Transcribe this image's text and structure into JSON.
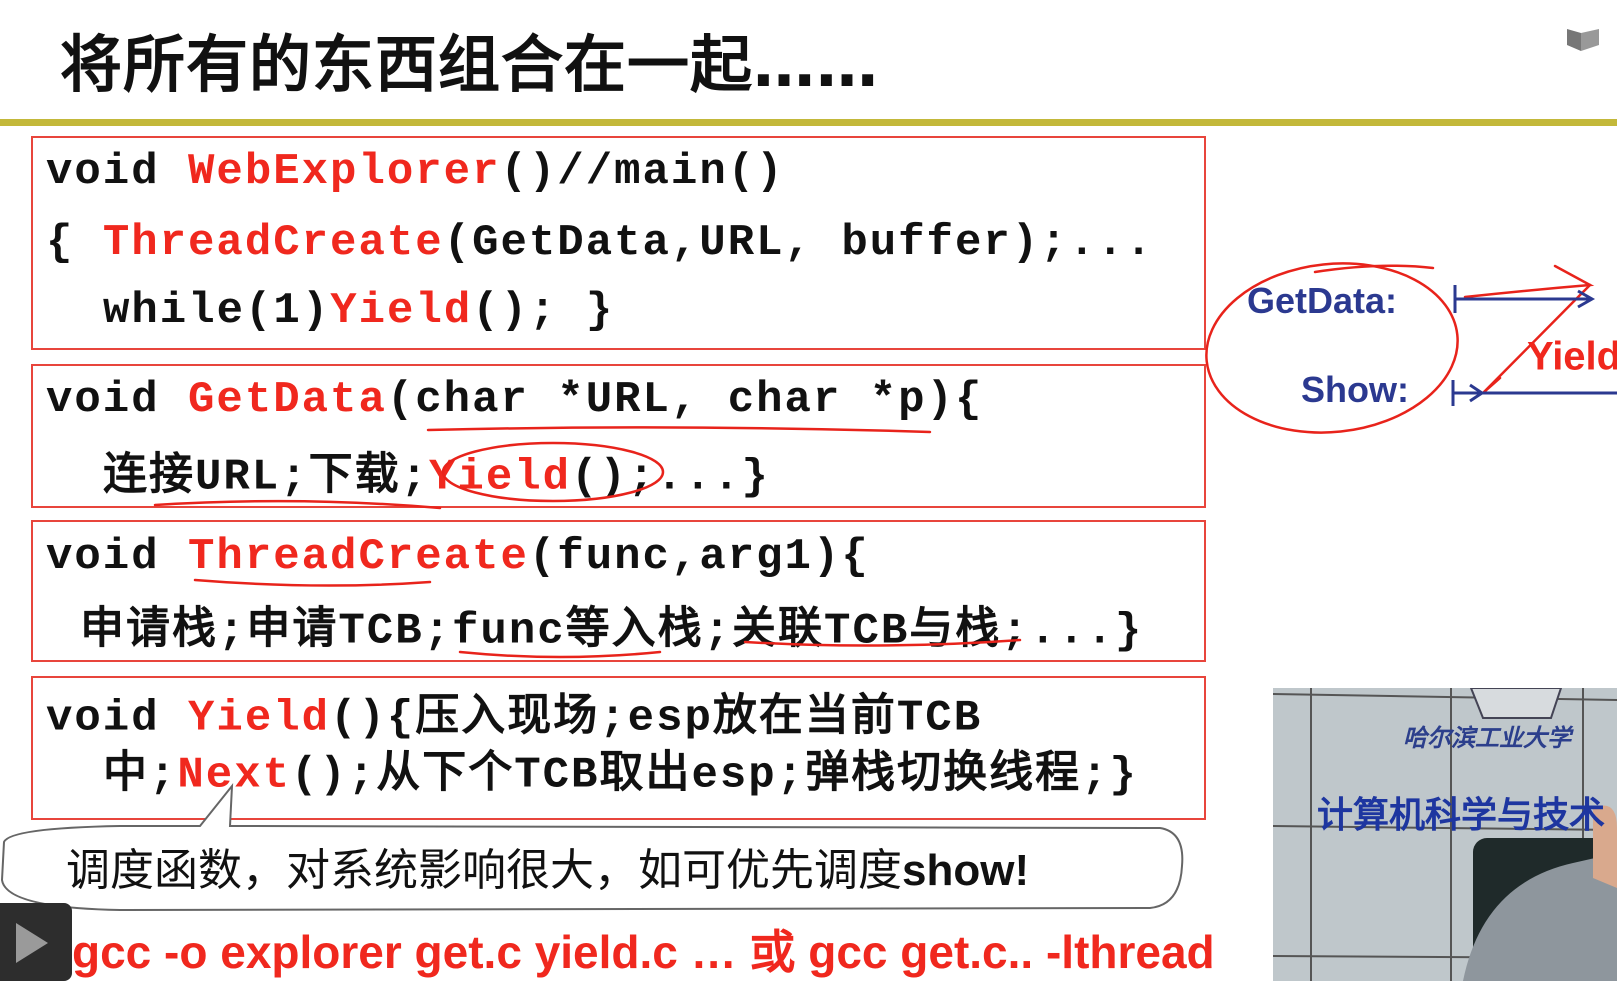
{
  "slide": {
    "title": "将所有的东西组合在一起……",
    "code_blocks": [
      {
        "lines": [
          [
            {
              "t": "void "
            },
            {
              "t": "WebExplorer",
              "r": true
            },
            {
              "t": "()//main()"
            }
          ],
          [
            {
              "t": "{ "
            },
            {
              "t": "ThreadCreate",
              "r": true
            },
            {
              "t": "(GetData,URL, buffer);..."
            }
          ],
          [
            {
              "t": "while(1)"
            },
            {
              "t": "Yield",
              "r": true
            },
            {
              "t": "(); }"
            }
          ]
        ]
      },
      {
        "lines": [
          [
            {
              "t": "void "
            },
            {
              "t": "GetData",
              "r": true
            },
            {
              "t": "(char *URL, char *p){"
            }
          ],
          [
            {
              "t": "连接URL;下载;"
            },
            {
              "t": "Yield",
              "r": true
            },
            {
              "t": "();...}"
            }
          ]
        ]
      },
      {
        "lines": [
          [
            {
              "t": "void "
            },
            {
              "t": "ThreadCreate",
              "r": true
            },
            {
              "t": "(func,arg1){"
            }
          ],
          [
            {
              "t": "申请栈;申请TCB;func等入栈;关联TCB与栈;...}"
            }
          ]
        ]
      },
      {
        "lines": [
          [
            {
              "t": "void "
            },
            {
              "t": "Yield",
              "r": true
            },
            {
              "t": "(){压入现场;esp放在当前TCB"
            }
          ],
          [
            {
              "t": "中;"
            },
            {
              "t": "Next",
              "r": true
            },
            {
              "t": "();从下个TCB取出esp;弹栈切换线程;}"
            }
          ]
        ]
      }
    ],
    "callout": {
      "text": "调度函数，对系统影响很大，如可优先调度",
      "bold": "show!"
    },
    "compile_line": "gcc -o explorer get.c yield.c … 或 gcc get.c.. -lthread",
    "diagram": {
      "getdata_label": "GetData:",
      "show_label": "Show:",
      "yield_label": "Yield"
    }
  },
  "video_inset": {
    "school": "哈尔滨工业大学",
    "department": "计算机科学与技术"
  },
  "player": {
    "play_icon": "play-icon"
  },
  "colors": {
    "accent_red": "#f0281e",
    "rule": "#c3b83a",
    "diagram_blue": "#2b3990"
  }
}
